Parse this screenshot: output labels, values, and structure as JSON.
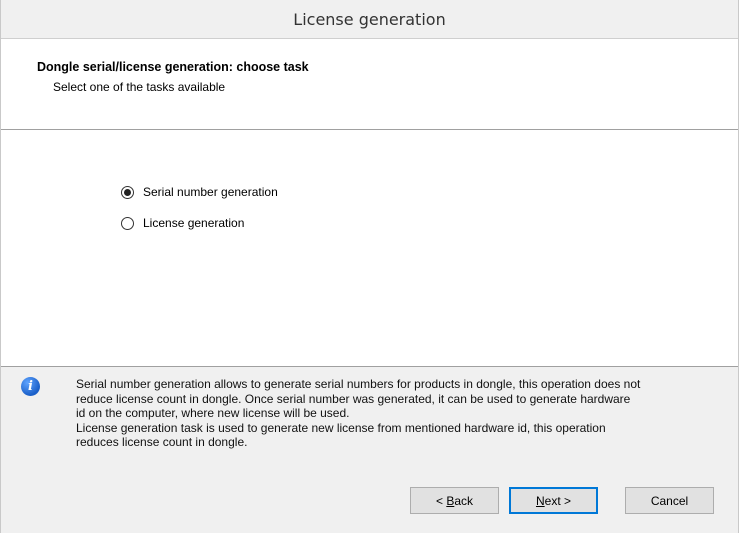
{
  "window": {
    "title": "License generation"
  },
  "header": {
    "title": "Dongle serial/license generation: choose task",
    "subtitle": "Select one of the tasks available"
  },
  "options": [
    {
      "label": "Serial number generation",
      "checked": true
    },
    {
      "label": "License generation",
      "checked": false
    }
  ],
  "info": {
    "icon": "info-icon",
    "lines": [
      "Serial number generation allows to generate serial numbers for products in dongle, this operation does not",
      "reduce license count in dongle. Once serial number was generated, it can be used to generate hardware",
      "id on the computer, where new license will be used.",
      "License generation task is used to generate new license from mentioned hardware id, this operation",
      "reduces license count in dongle."
    ]
  },
  "buttons": {
    "back": {
      "prefix": "< ",
      "mnemonic": "B",
      "rest": "ack"
    },
    "next": {
      "mnemonic": "N",
      "rest": "ext >"
    },
    "cancel": "Cancel"
  }
}
